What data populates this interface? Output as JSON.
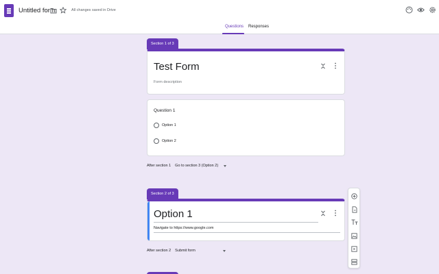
{
  "header": {
    "form_title": "Untitled form",
    "saved_status": "All changes saved in Drive"
  },
  "tabs": [
    {
      "label": "Questions",
      "active": true
    },
    {
      "label": "Responses",
      "active": false
    }
  ],
  "sections": [
    {
      "badge": "Section 1 of 3",
      "title": "Test Form",
      "description": "Form description",
      "question": {
        "title": "Question 1",
        "options": [
          "Option 1",
          "Option 2"
        ]
      },
      "after_label": "After section 1",
      "after_value": "Go to section 3 (Option 2)"
    },
    {
      "badge": "Section 2 of 3",
      "title": "Option 1",
      "description": "Navigate to https://www.google.com",
      "after_label": "After section 2",
      "after_value": "Submit form"
    }
  ],
  "colors": {
    "accent": "#673ab7",
    "background": "#ede7f6",
    "focus": "#4285f4"
  },
  "toolbar_icons": [
    "add-question-icon",
    "import-questions-icon",
    "add-title-icon",
    "add-image-icon",
    "add-video-icon",
    "add-section-icon"
  ]
}
